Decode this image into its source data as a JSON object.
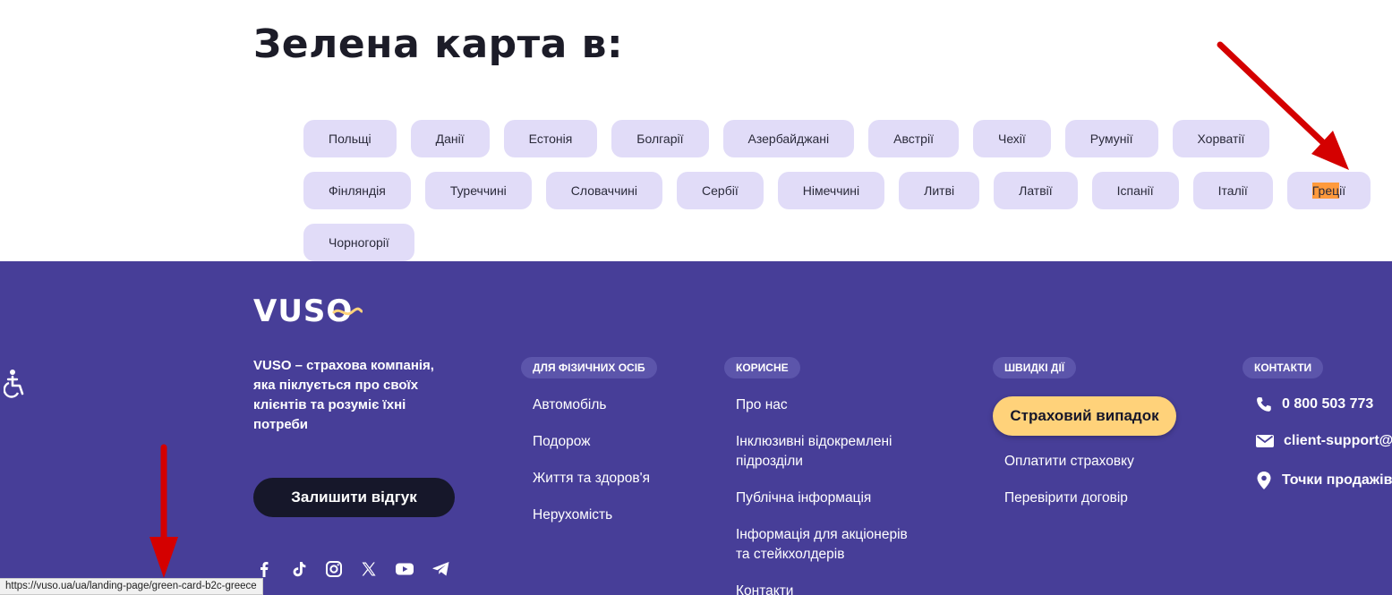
{
  "heading": "Зелена карта в:",
  "countries_row1": [
    "Польщі",
    "Данії",
    "Естонія",
    "Болгарії",
    "Азербайджані",
    "Австрії",
    "Чехії",
    "Румунії",
    "Хорватії"
  ],
  "countries_row2": [
    "Фінляндія",
    "Туреччині",
    "Словаччині",
    "Сербії",
    "Німеччині",
    "Литві",
    "Латвії",
    "Іспанії",
    "Італії"
  ],
  "country_highlight": {
    "prefix": "Грец",
    "suffix": "ії"
  },
  "countries_row3": [
    "Чорногорії"
  ],
  "footer": {
    "logo": "VUSO",
    "about": "VUSO – страхова компанія, яка піклується про своїх клієнтів та розуміє їхні потреби",
    "feedback_button": "Залишити відгук",
    "col_individuals": {
      "badge": "ДЛЯ ФІЗИЧНИХ ОСІБ",
      "links": [
        "Автомобіль",
        "Подорож",
        "Життя та здоров'я",
        "Нерухомість"
      ]
    },
    "col_useful": {
      "badge": "КОРИСНЕ",
      "links": [
        "Про нас",
        "Інклюзивні відокремлені",
        "підрозділи",
        "Публічна інформація",
        "Інформація для акціонерів",
        "та стейкхолдерів",
        "Контакти"
      ]
    },
    "col_quick": {
      "badge": "ШВИДКІ ДІЇ",
      "claim_button": "Страховий випадок",
      "links": [
        "Оплатити страховку",
        "Перевірити договір"
      ]
    },
    "col_contacts": {
      "badge": "КОНТАКТИ",
      "phone": "0 800 503 773",
      "email": "client-support@",
      "points": "Точки продажів"
    }
  },
  "status_url": "https://vuso.ua/ua/landing-page/green-card-b2c-greece",
  "colors": {
    "footer_bg": "#473e98",
    "chip_bg": "#e1dcf8",
    "accent_yellow": "#ffd27a",
    "highlight": "#ff9a3c",
    "arrow": "#d40000"
  },
  "icons": [
    "accessibility-icon",
    "facebook-icon",
    "tiktok-icon",
    "instagram-icon",
    "x-icon",
    "youtube-icon",
    "telegram-icon",
    "phone-icon",
    "mail-icon",
    "location-pin-icon",
    "red-arrow"
  ]
}
